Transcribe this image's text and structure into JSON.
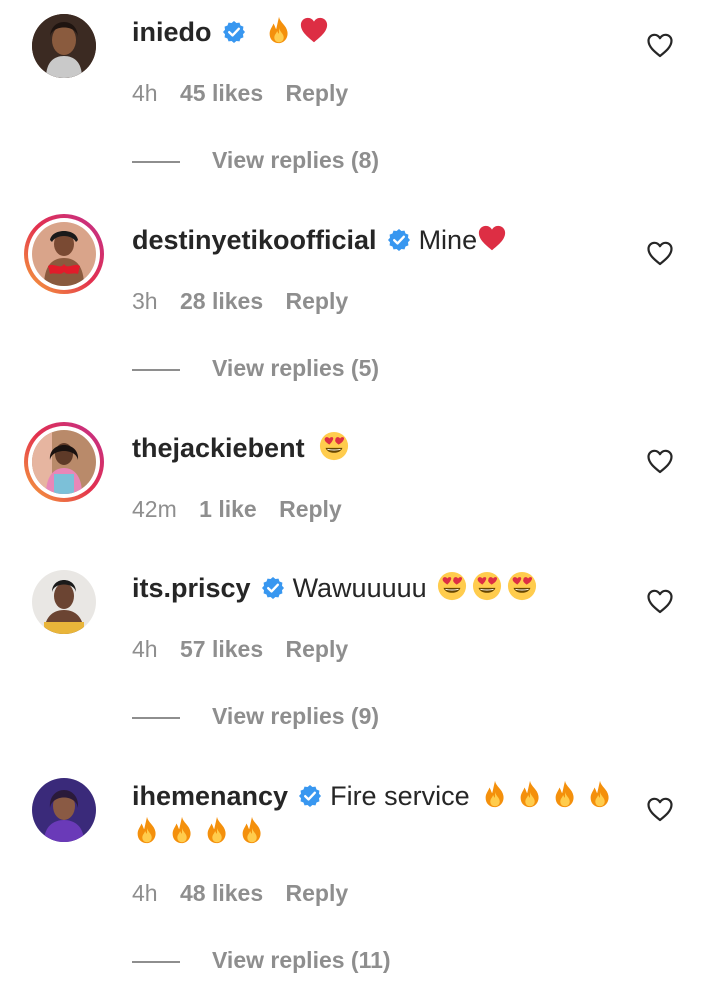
{
  "comments": [
    {
      "username": "iniedo",
      "verified": true,
      "text": "",
      "emojis": [
        "fire-emoji",
        "red-heart-emoji"
      ],
      "time": "4h",
      "likes": "45 likes",
      "reply": "Reply",
      "view_replies": "View replies (8)"
    },
    {
      "username": "destinyetikoofficial",
      "verified": true,
      "text": "Mine",
      "emojis": [
        "red-heart-emoji"
      ],
      "time": "3h",
      "likes": "28 likes",
      "reply": "Reply",
      "view_replies": "View replies (5)"
    },
    {
      "username": "thejackiebent",
      "verified": false,
      "text": "",
      "emojis": [
        "heart-eyes-emoji"
      ],
      "time": "42m",
      "likes": "1 like",
      "reply": "Reply",
      "view_replies": ""
    },
    {
      "username": "its.priscy",
      "verified": true,
      "text": "Wawuuuuu",
      "emojis": [
        "heart-eyes-emoji",
        "heart-eyes-emoji",
        "heart-eyes-emoji"
      ],
      "time": "4h",
      "likes": "57 likes",
      "reply": "Reply",
      "view_replies": "View replies (9)"
    },
    {
      "username": "ihemenancy",
      "verified": true,
      "text": "Fire service",
      "emojis": [
        "fire-emoji",
        "fire-emoji",
        "fire-emoji",
        "fire-emoji",
        "fire-emoji",
        "fire-emoji",
        "fire-emoji",
        "fire-emoji"
      ],
      "time": "4h",
      "likes": "48 likes",
      "reply": "Reply",
      "view_replies": "View replies (11)"
    }
  ],
  "colors": {
    "text": "#262626",
    "muted": "#8e8e8e",
    "verified": "#3897f0",
    "story_ring_start": "#f6a83a",
    "story_ring_end": "#c02f8e"
  }
}
